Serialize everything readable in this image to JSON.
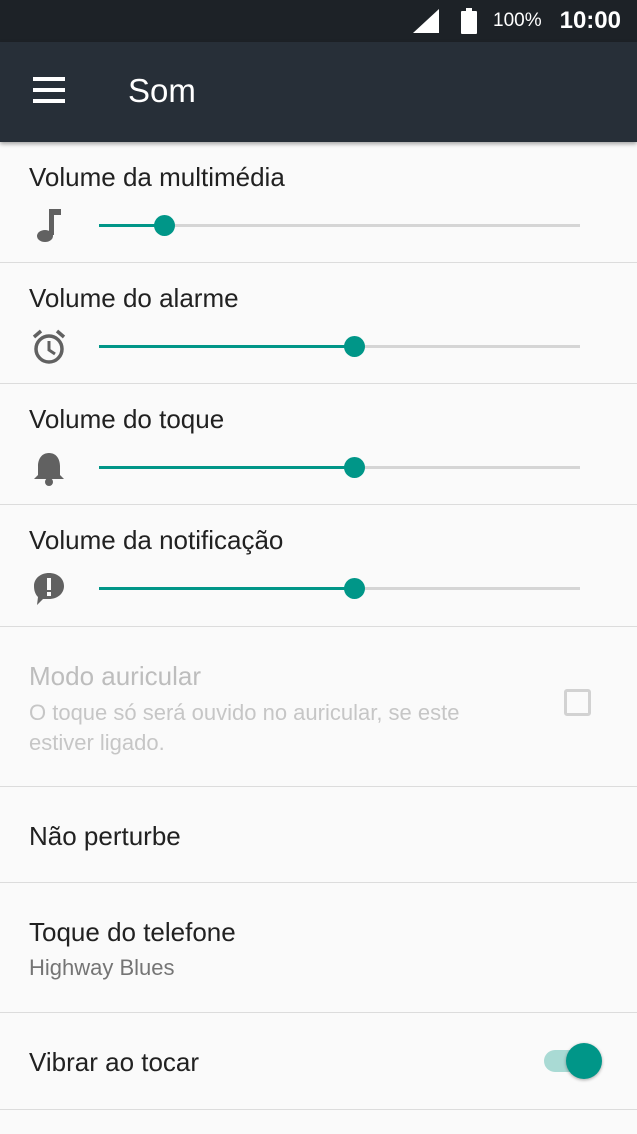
{
  "status_bar": {
    "battery": "100%",
    "time": "10:00"
  },
  "header": {
    "title": "Som"
  },
  "volumes": [
    {
      "label": "Volume da multimédia",
      "icon": "music-note-icon",
      "level": 0.135
    },
    {
      "label": "Volume do alarme",
      "icon": "alarm-clock-icon",
      "level": 0.53
    },
    {
      "label": "Volume do toque",
      "icon": "bell-icon",
      "level": 0.53
    },
    {
      "label": "Volume da notificação",
      "icon": "notification-alert-icon",
      "level": 0.53
    }
  ],
  "earpiece": {
    "label": "Modo auricular",
    "description_line1": "O toque só será ouvido no auricular, se este",
    "description_line2": "estiver ligado.",
    "checked": false,
    "enabled": false
  },
  "do_not_disturb": {
    "label": "Não perturbe"
  },
  "ringtone": {
    "label": "Toque do telefone",
    "value": "Highway Blues"
  },
  "vibrate": {
    "label": "Vibrar ao tocar",
    "on": true
  },
  "colors": {
    "accent": "#009688",
    "toolbar": "#272f38",
    "status_bar": "#1d2227"
  }
}
